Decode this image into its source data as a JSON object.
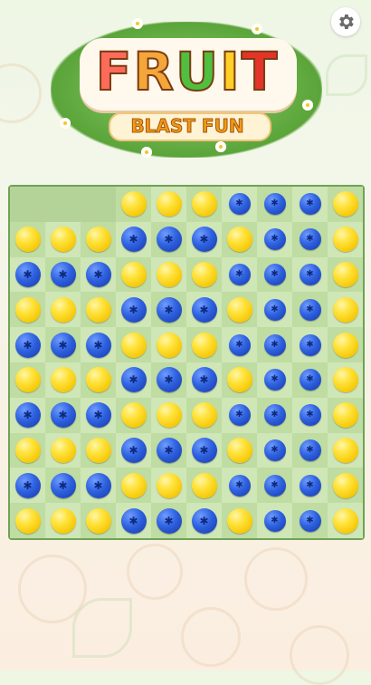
{
  "app": {
    "title_word": "FRUIT",
    "title_letter_colors": [
      "#ff6b5a",
      "#f4a63a",
      "#4fbf3f",
      "#ffcf26",
      "#e4342a"
    ],
    "subtitle": "BLAST FUN"
  },
  "settings": {
    "icon": "gear-icon"
  },
  "board": {
    "rows": 10,
    "cols": 10,
    "grid": [
      [
        "empty",
        "empty",
        "empty",
        "lemon",
        "lemon",
        "lemon",
        "blueberry",
        "blueberry",
        "blueberry",
        "lemon"
      ],
      [
        "lemon",
        "lemon",
        "lemon",
        "blueberry",
        "blueberry",
        "blueberry",
        "lemon",
        "blueberry",
        "blueberry",
        "lemon"
      ],
      [
        "blueberry",
        "blueberry",
        "blueberry",
        "lemon",
        "lemon",
        "lemon",
        "blueberry",
        "blueberry",
        "blueberry",
        "lemon"
      ],
      [
        "lemon",
        "lemon",
        "lemon",
        "blueberry",
        "blueberry",
        "blueberry",
        "lemon",
        "blueberry",
        "blueberry",
        "lemon"
      ],
      [
        "blueberry",
        "blueberry",
        "blueberry",
        "lemon",
        "lemon",
        "lemon",
        "blueberry",
        "blueberry",
        "blueberry",
        "lemon"
      ],
      [
        "lemon",
        "lemon",
        "lemon",
        "blueberry",
        "blueberry",
        "blueberry",
        "lemon",
        "blueberry",
        "blueberry",
        "lemon"
      ],
      [
        "blueberry",
        "blueberry",
        "blueberry",
        "lemon",
        "lemon",
        "lemon",
        "blueberry",
        "blueberry",
        "blueberry",
        "lemon"
      ],
      [
        "lemon",
        "lemon",
        "lemon",
        "blueberry",
        "blueberry",
        "blueberry",
        "lemon",
        "blueberry",
        "blueberry",
        "lemon"
      ],
      [
        "blueberry",
        "blueberry",
        "blueberry",
        "lemon",
        "lemon",
        "lemon",
        "blueberry",
        "blueberry",
        "blueberry",
        "lemon"
      ],
      [
        "lemon",
        "lemon",
        "lemon",
        "blueberry",
        "blueberry",
        "blueberry",
        "lemon",
        "blueberry",
        "blueberry",
        "lemon"
      ]
    ]
  }
}
